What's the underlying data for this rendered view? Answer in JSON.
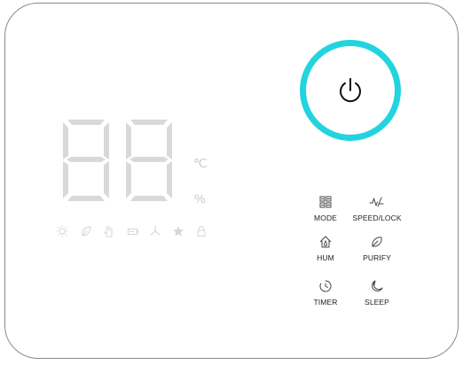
{
  "display": {
    "temp_unit": "℃",
    "humidity_unit": "%"
  },
  "power": {
    "icon": "power-icon",
    "ring_color": "#22d4de"
  },
  "indicators": [
    "sun-icon",
    "leaf-icon",
    "hand-icon",
    "battery-icon",
    "fan-icon",
    "star-icon",
    "lock-icon"
  ],
  "buttons": {
    "mode": "MODE",
    "speed_lock": "SPEED/LOCK",
    "hum": "HUM",
    "purify": "PURIFY",
    "timer": "TIMER",
    "sleep": "SLEEP"
  }
}
